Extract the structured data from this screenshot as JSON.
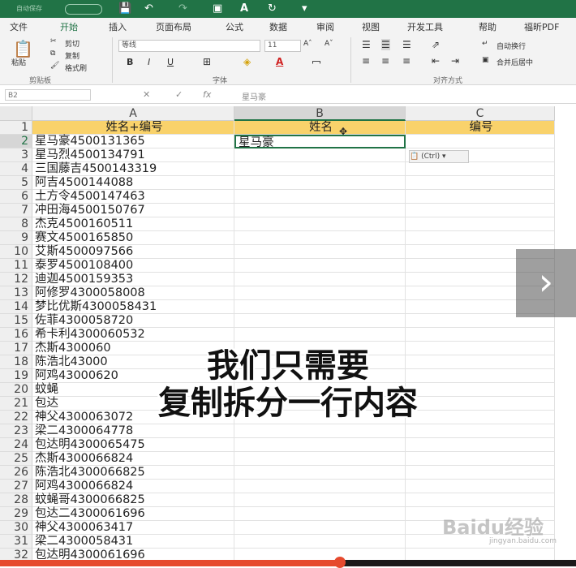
{
  "titlebar": {
    "autosave_label": "自动保存",
    "icons": [
      "save-icon",
      "undo-icon",
      "redo-icon",
      "camera-icon",
      "font-color-icon",
      "sync-icon",
      "more-icon"
    ]
  },
  "ribbon_tabs": [
    "文件",
    "开始",
    "插入",
    "页面布局",
    "公式",
    "数据",
    "审阅",
    "视图",
    "开发工具",
    "帮助",
    "福昕PDF"
  ],
  "active_tab": "开始",
  "clipboard": {
    "paste": "粘贴",
    "cut": "剪切",
    "copy": "复制",
    "format_painter": "格式刷",
    "group": "剪贴板"
  },
  "font": {
    "name": "等线",
    "size": "11",
    "group": "字体",
    "bold": "B",
    "italic": "I",
    "underline": "U"
  },
  "alignment": {
    "wrap": "自动换行",
    "merge": "合并后居中",
    "group": "对齐方式"
  },
  "formula_bar": {
    "name_box": "B2",
    "content": "星马豪"
  },
  "columns": [
    "A",
    "B",
    "C"
  ],
  "selected_column": "B",
  "selected_row": "2",
  "rows": [
    {
      "n": "1",
      "a": "姓名+编号",
      "b": "姓名",
      "c": "编号"
    },
    {
      "n": "2",
      "a": "星马豪4500131365",
      "b": "星马豪",
      "c": ""
    },
    {
      "n": "3",
      "a": "星马烈4500134791",
      "b": "",
      "c": ""
    },
    {
      "n": "4",
      "a": "三国藤吉4500143319",
      "b": "",
      "c": ""
    },
    {
      "n": "5",
      "a": "阿吉4500144088",
      "b": "",
      "c": ""
    },
    {
      "n": "6",
      "a": "土方令4500147463",
      "b": "",
      "c": ""
    },
    {
      "n": "7",
      "a": "冲田海4500150767",
      "b": "",
      "c": ""
    },
    {
      "n": "8",
      "a": "杰克4500160511",
      "b": "",
      "c": ""
    },
    {
      "n": "9",
      "a": "赛文4500165850",
      "b": "",
      "c": ""
    },
    {
      "n": "10",
      "a": "艾斯4500097566",
      "b": "",
      "c": ""
    },
    {
      "n": "11",
      "a": "泰罗4500108400",
      "b": "",
      "c": ""
    },
    {
      "n": "12",
      "a": "迪迦4500159353",
      "b": "",
      "c": ""
    },
    {
      "n": "13",
      "a": "阿修罗4300058008",
      "b": "",
      "c": ""
    },
    {
      "n": "14",
      "a": "梦比优斯4300058431",
      "b": "",
      "c": ""
    },
    {
      "n": "15",
      "a": "佐菲4300058720",
      "b": "",
      "c": ""
    },
    {
      "n": "16",
      "a": "希卡利4300060532",
      "b": "",
      "c": ""
    },
    {
      "n": "17",
      "a": "杰斯4300060",
      "b": "",
      "c": ""
    },
    {
      "n": "18",
      "a": "陈浩北43000",
      "b": "",
      "c": ""
    },
    {
      "n": "19",
      "a": "阿鸡43000620",
      "b": "",
      "c": ""
    },
    {
      "n": "20",
      "a": "蚊蝇",
      "b": "",
      "c": ""
    },
    {
      "n": "21",
      "a": "包达",
      "b": "",
      "c": ""
    },
    {
      "n": "22",
      "a": "神父4300063072",
      "b": "",
      "c": ""
    },
    {
      "n": "23",
      "a": "梁二4300064778",
      "b": "",
      "c": ""
    },
    {
      "n": "24",
      "a": "包达明4300065475",
      "b": "",
      "c": ""
    },
    {
      "n": "25",
      "a": "杰斯4300066824",
      "b": "",
      "c": ""
    },
    {
      "n": "26",
      "a": "陈浩北4300066825",
      "b": "",
      "c": ""
    },
    {
      "n": "27",
      "a": "阿鸡4300066824",
      "b": "",
      "c": ""
    },
    {
      "n": "28",
      "a": "蚊蝇哥4300066825",
      "b": "",
      "c": ""
    },
    {
      "n": "29",
      "a": "包达二4300061696",
      "b": "",
      "c": ""
    },
    {
      "n": "30",
      "a": "神父4300063417",
      "b": "",
      "c": ""
    },
    {
      "n": "31",
      "a": "梁二4300058431",
      "b": "",
      "c": ""
    },
    {
      "n": "32",
      "a": "包达明4300061696",
      "b": "",
      "c": ""
    }
  ],
  "paste_options_label": "(Ctrl)",
  "overlay": {
    "line1": "我们只需要",
    "line2": "复制拆分一行内容"
  },
  "watermark": {
    "brand": "Baidu经验",
    "site": "jingyan.baidu.com"
  },
  "video": {
    "progress": 0.59
  },
  "colors": {
    "accent": "#217346",
    "header_fill": "#f9d26b",
    "progress": "#e64a2e"
  }
}
